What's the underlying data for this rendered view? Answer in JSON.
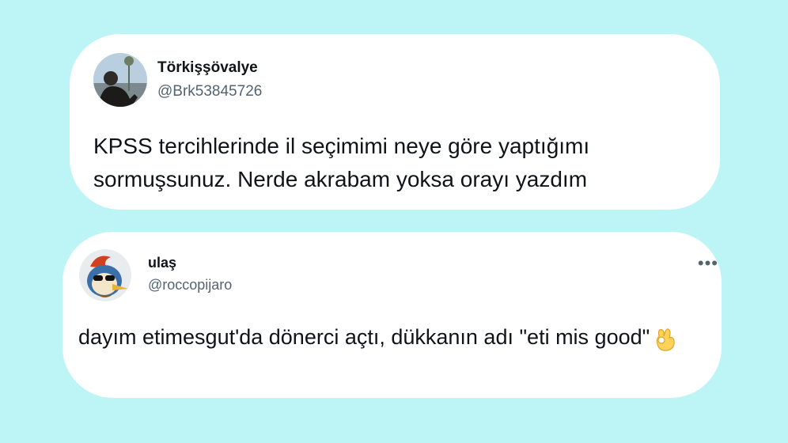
{
  "tweets": [
    {
      "display_name": "Törkişşövalye",
      "handle": "@Brk53845726",
      "text": "KPSS tercihlerinde il seçimimi neye göre yaptığımı sormuşsunuz. Nerde akrabam yoksa orayı yazdım",
      "avatar_icon": "person-photo-avatar"
    },
    {
      "display_name": "ulaş",
      "handle": "@roccopijaro",
      "text": "dayım etimesgut'da dönerci açtı, dükkanın adı \"eti mis good\"",
      "emoji_icon": "ok-hand-icon",
      "more_icon": "more-dots-icon",
      "avatar_icon": "cartoon-woodpecker-avatar"
    }
  ]
}
